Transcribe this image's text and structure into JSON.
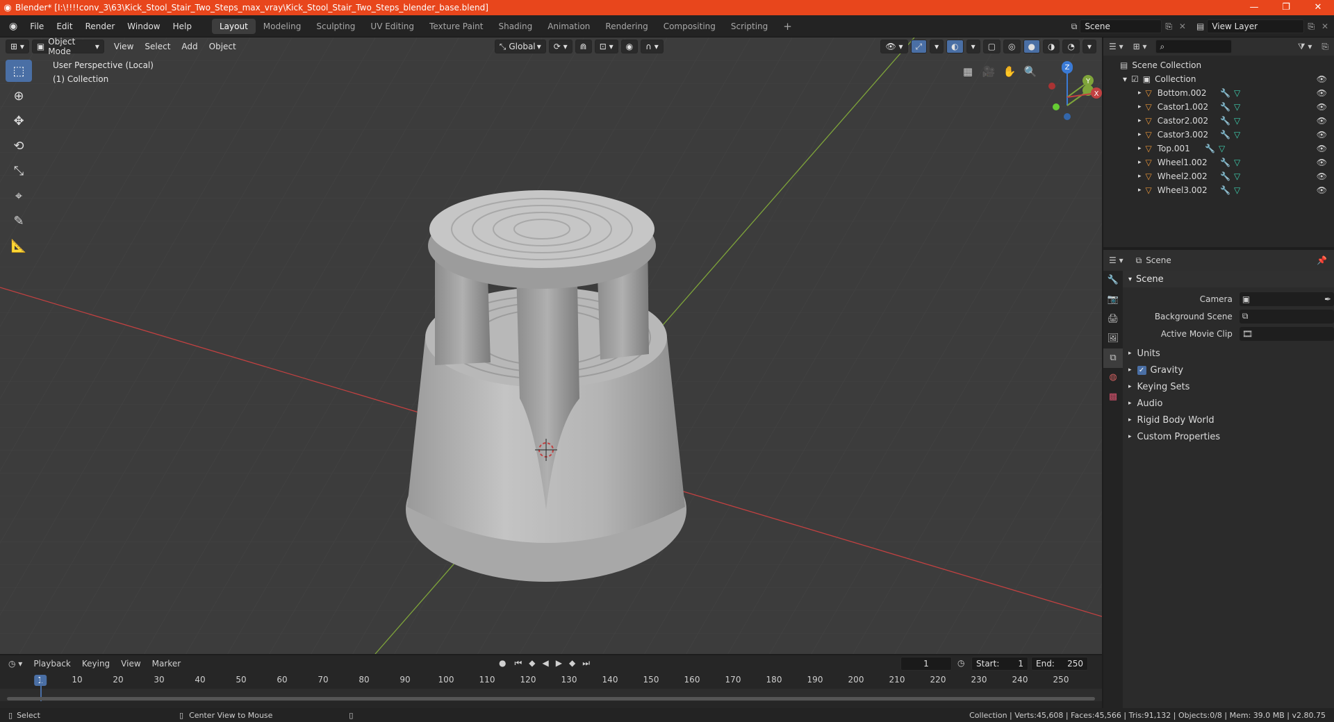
{
  "window": {
    "title": "Blender* [I:\\!!!!conv_3\\63\\Kick_Stool_Stair_Two_Steps_max_vray\\Kick_Stool_Stair_Two_Steps_blender_base.blend]",
    "minimize": "—",
    "maximize": "❐",
    "close": "✕"
  },
  "menu": [
    "File",
    "Edit",
    "Render",
    "Window",
    "Help"
  ],
  "workspaces": [
    "Layout",
    "Modeling",
    "Sculpting",
    "UV Editing",
    "Texture Paint",
    "Shading",
    "Animation",
    "Rendering",
    "Compositing",
    "Scripting"
  ],
  "add_workspace": "+",
  "scene_field": "Scene",
  "view_layer_field": "View Layer",
  "viewport": {
    "mode": "Object Mode",
    "menus": [
      "View",
      "Select",
      "Add",
      "Object"
    ],
    "orientation": "Global",
    "info_line1": "User Perspective (Local)",
    "info_line2": "(1) Collection",
    "gizmo": {
      "x": "X",
      "y": "Y",
      "z": "Z"
    }
  },
  "outliner": {
    "root": "Scene Collection",
    "collection": "Collection",
    "items": [
      "Bottom.002",
      "Castor1.002",
      "Castor2.002",
      "Castor3.002",
      "Top.001",
      "Wheel1.002",
      "Wheel2.002",
      "Wheel3.002"
    ]
  },
  "properties": {
    "context": "Scene",
    "panel": "Scene",
    "rows": [
      {
        "label": "Camera"
      },
      {
        "label": "Background Scene"
      },
      {
        "label": "Active Movie Clip"
      }
    ],
    "subpanels": [
      "Units",
      "Gravity",
      "Keying Sets",
      "Audio",
      "Rigid Body World",
      "Custom Properties"
    ]
  },
  "timeline": {
    "menus": [
      "Playback",
      "Keying",
      "View",
      "Marker"
    ],
    "current_frame": "1",
    "start_label": "Start:",
    "start": "1",
    "end_label": "End:",
    "end": "250",
    "ruler_current": "1",
    "ruler": [
      "10",
      "20",
      "30",
      "40",
      "50",
      "60",
      "70",
      "80",
      "90",
      "100",
      "110",
      "120",
      "130",
      "140",
      "150",
      "160",
      "170",
      "180",
      "190",
      "200",
      "210",
      "220",
      "230",
      "240",
      "250"
    ]
  },
  "status": {
    "left1": "Select",
    "left2": "Center View to Mouse",
    "right": "Collection | Verts:45,608 | Faces:45,566 | Tris:91,132 | Objects:0/8 | Mem: 39.0 MB | v2.80.75"
  },
  "colors": {
    "accent": "#4a6fa5",
    "titlebar": "#e8461c",
    "x_axis": "#c24141",
    "y_axis": "#7fa53a",
    "object_icon": "#e8963a"
  }
}
